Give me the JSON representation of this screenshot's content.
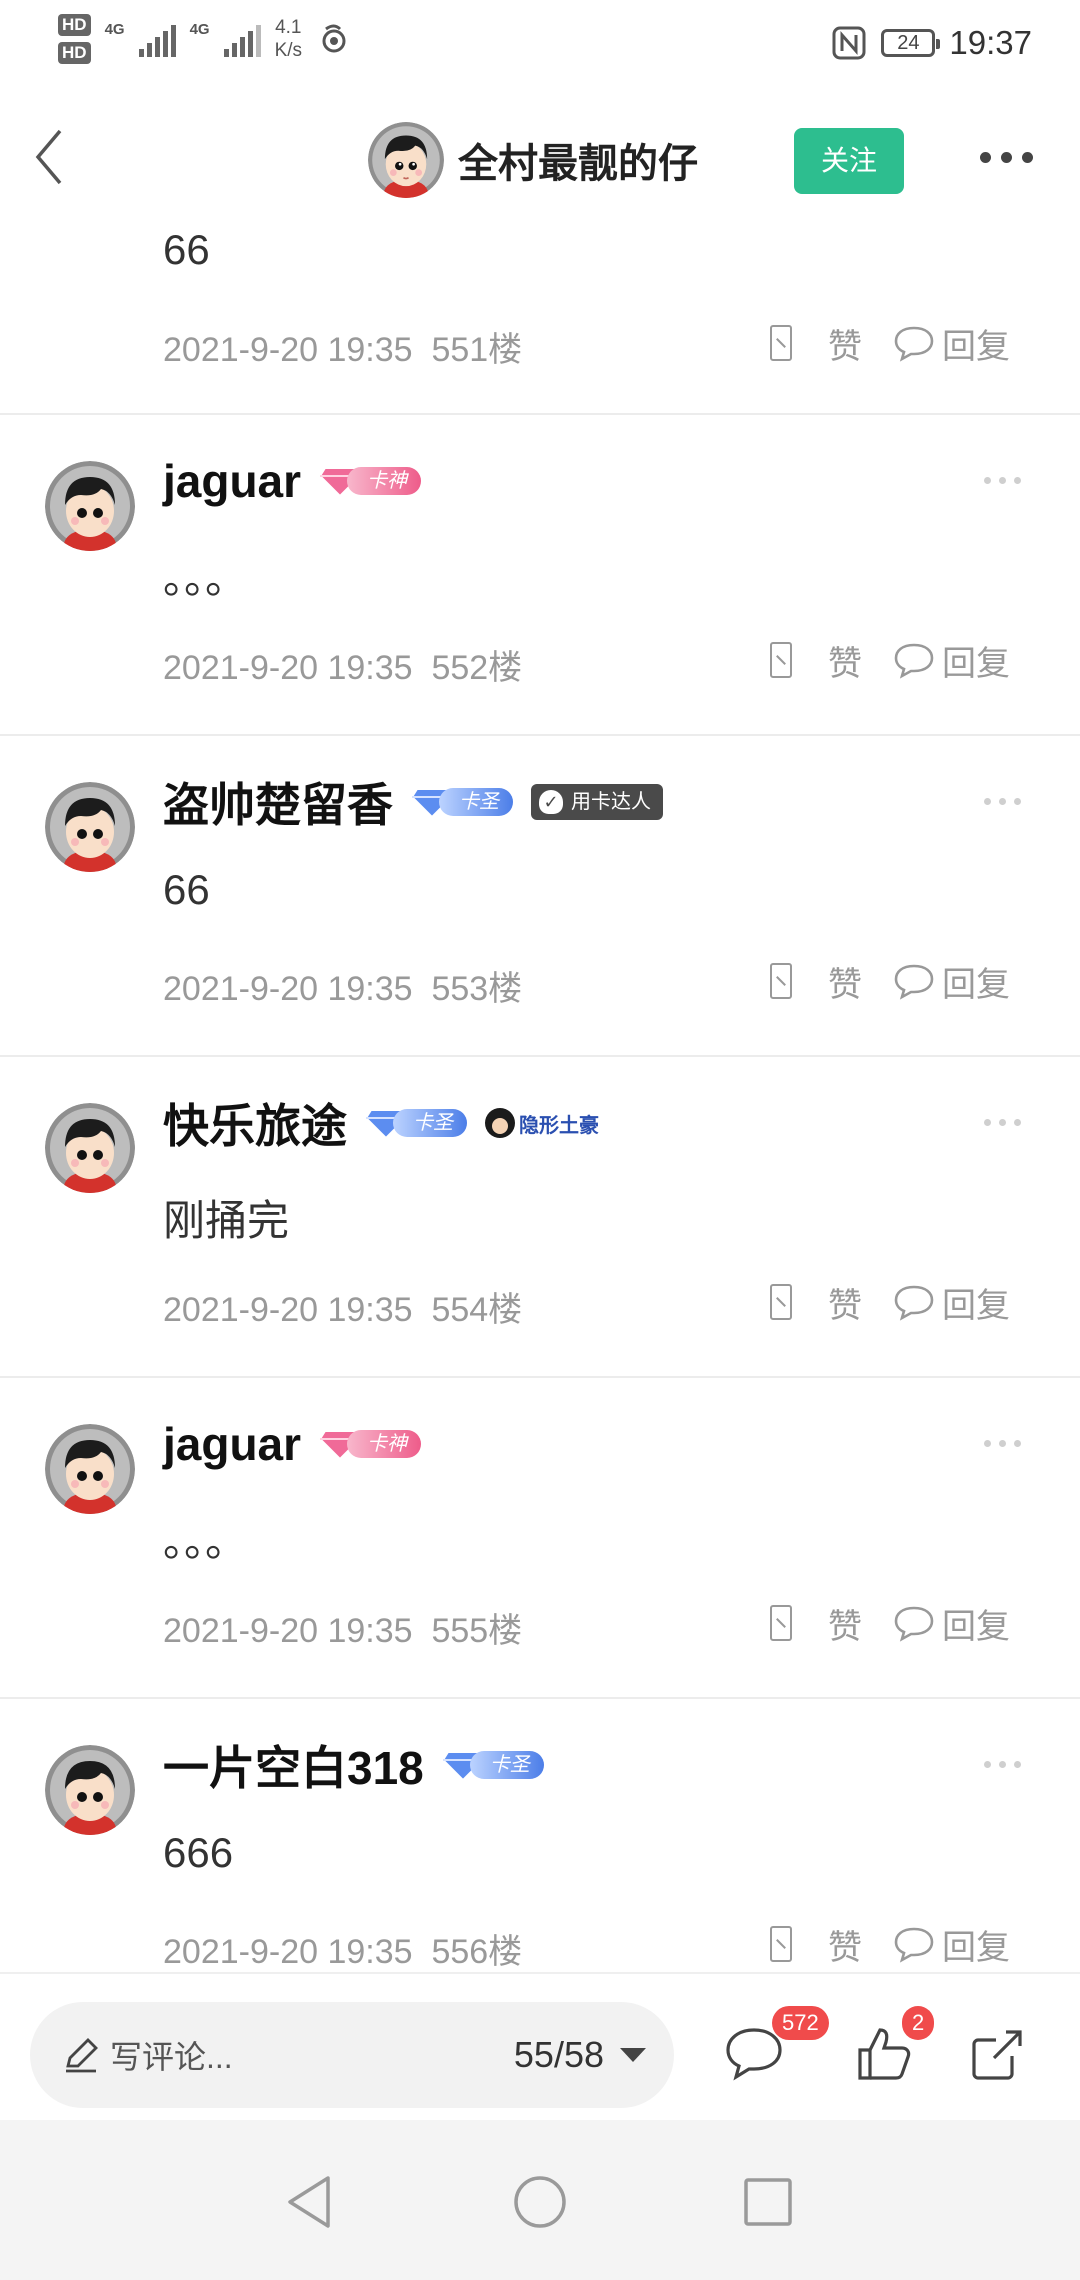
{
  "status_bar": {
    "hd1": "HD",
    "hd2": "HD",
    "sim1_label": "4G",
    "sim2_label": "4G",
    "speed_value": "4.1",
    "speed_unit": "K/s",
    "battery": "24",
    "time": "19:37"
  },
  "header": {
    "back_icon": "chevron-left-icon",
    "title": "全村最靓的仔",
    "follow_label": "关注",
    "more_icon": "more-icon"
  },
  "actions": {
    "like_label": "赞",
    "reply_label": "回复"
  },
  "posts": [
    {
      "content": "66",
      "date": "2021-9-20 19:35",
      "floor": "551楼"
    },
    {
      "username": "jaguar",
      "level_badge": "卡神",
      "content": "。。。",
      "date": "2021-9-20 19:35",
      "floor": "552楼"
    },
    {
      "username": "盗帅楚留香",
      "level_badge": "卡圣",
      "extra_badge": "用卡达人",
      "content": "66",
      "date": "2021-9-20 19:35",
      "floor": "553楼"
    },
    {
      "username": "快乐旅途",
      "level_badge": "卡圣",
      "extra_badge": "隐形土豪",
      "content": "刚捅完",
      "date": "2021-9-20 19:35",
      "floor": "554楼"
    },
    {
      "username": "jaguar",
      "level_badge": "卡神",
      "content": "。。。",
      "date": "2021-9-20 19:35",
      "floor": "555楼"
    },
    {
      "username": "一片空白318",
      "level_badge": "卡圣",
      "content": "666",
      "date": "2021-9-20 19:35",
      "floor": "556楼"
    }
  ],
  "bottom_bar": {
    "write_placeholder": "写评论...",
    "page": "55/58",
    "comment_count": "572",
    "like_count": "2"
  },
  "colors": {
    "accent_green": "#2dbe8f",
    "badge_red": "#f04b4b",
    "meta_gray": "#999999"
  }
}
